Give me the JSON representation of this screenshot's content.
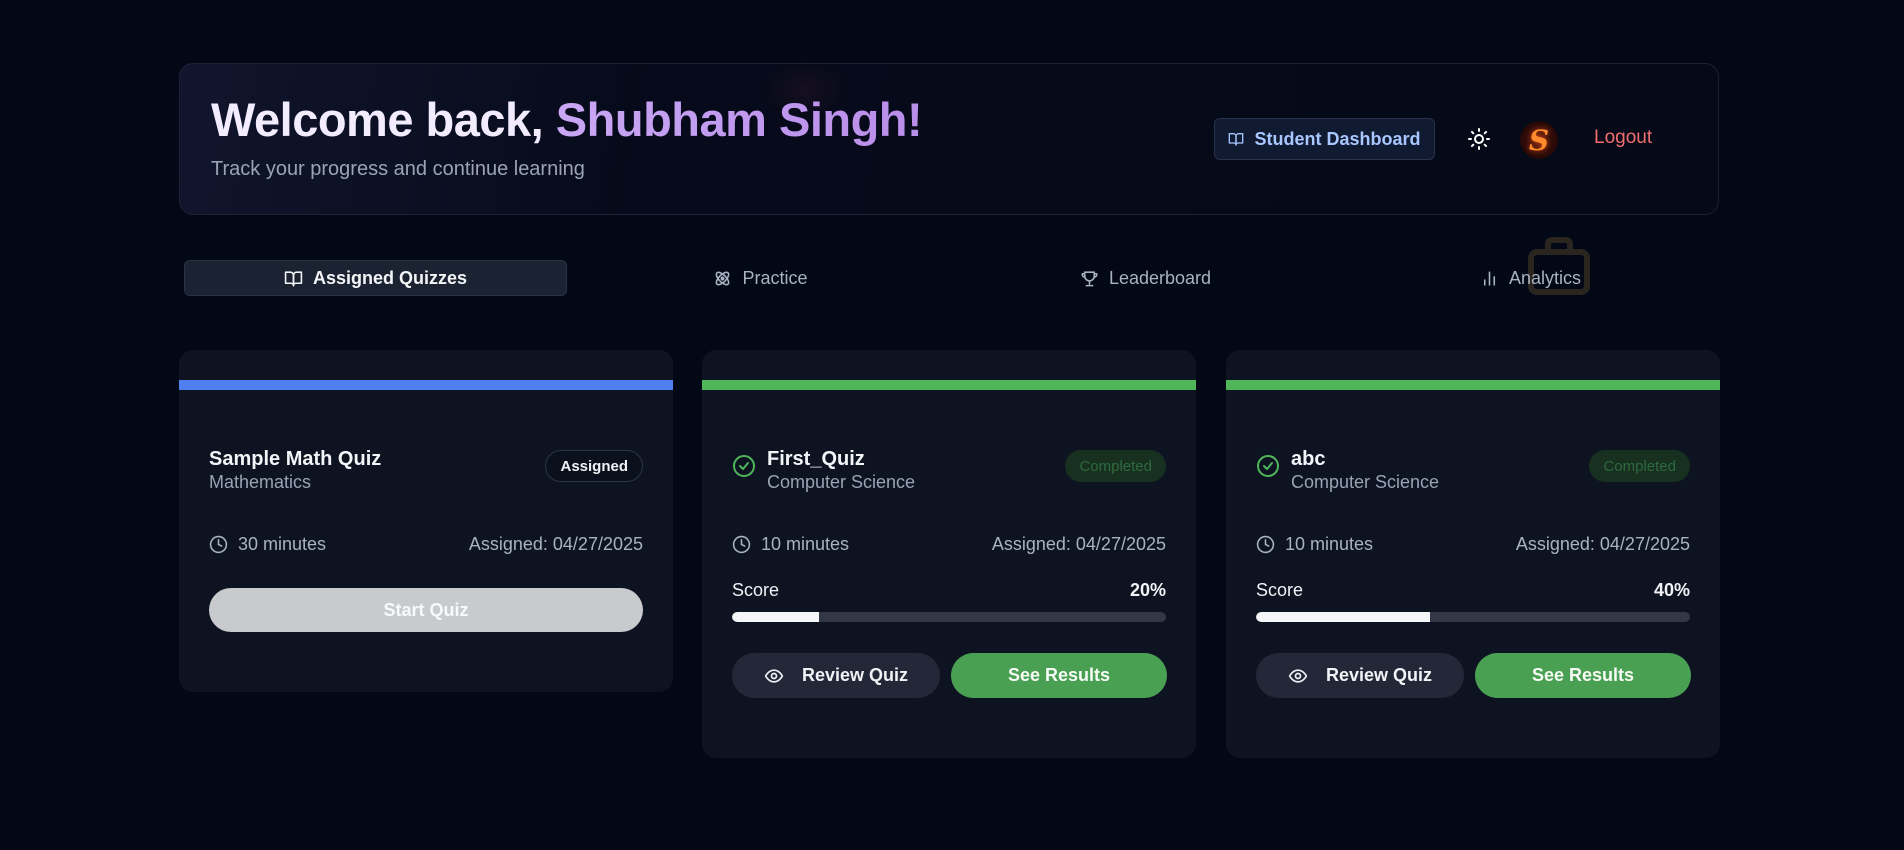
{
  "header": {
    "welcome_prefix": "Welcome back, ",
    "user_name": "Shubham Singh!",
    "subtitle": "Track your progress and continue learning",
    "dashboard_label": "Student Dashboard",
    "avatar_letter": "S",
    "logout_label": "Logout"
  },
  "tabs": [
    {
      "label": "Assigned Quizzes",
      "icon": "book-open-icon",
      "active": true
    },
    {
      "label": "Practice",
      "icon": "atom-icon",
      "active": false
    },
    {
      "label": "Leaderboard",
      "icon": "trophy-icon",
      "active": false
    },
    {
      "label": "Analytics",
      "icon": "bar-chart-icon",
      "active": false
    }
  ],
  "quizzes": [
    {
      "title": "Sample Math Quiz",
      "subject": "Mathematics",
      "status": "Assigned",
      "duration": "30 minutes",
      "assigned": "Assigned: 04/27/2025",
      "action_label": "Start Quiz",
      "stripe_color": "#4f7ff0"
    },
    {
      "title": "First_Quiz",
      "subject": "Computer Science",
      "status": "Completed",
      "duration": "10 minutes",
      "assigned": "Assigned: 04/27/2025",
      "score_label": "Score",
      "score": "20%",
      "score_fraction": 0.2,
      "review_label": "Review Quiz",
      "results_label": "See Results",
      "stripe_color": "#4fb65a"
    },
    {
      "title": "abc",
      "subject": "Computer Science",
      "status": "Completed",
      "duration": "10 minutes",
      "assigned": "Assigned: 04/27/2025",
      "score_label": "Score",
      "score": "40%",
      "score_fraction": 0.4,
      "review_label": "Review Quiz",
      "results_label": "See Results",
      "stripe_color": "#4fb65a"
    }
  ]
}
